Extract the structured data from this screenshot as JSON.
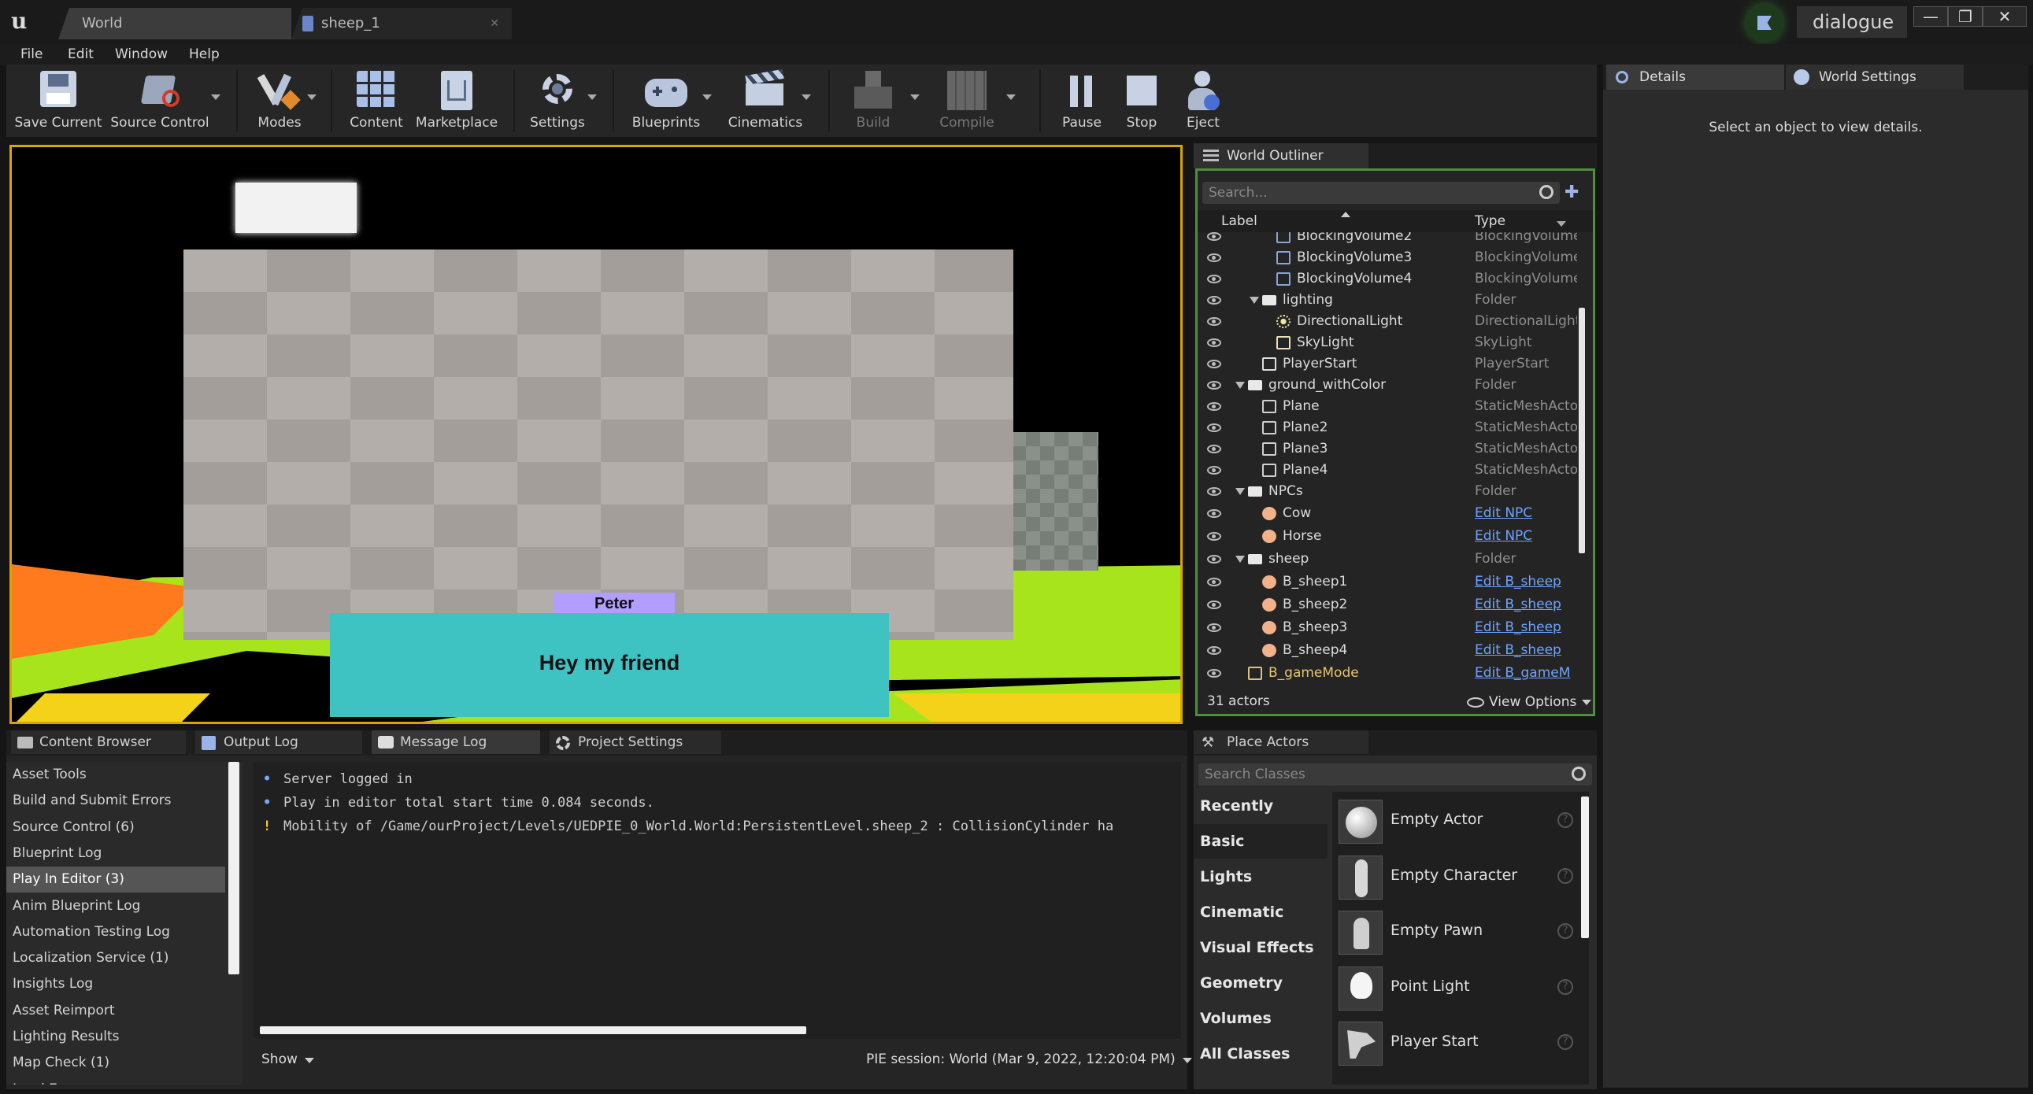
{
  "title_bar": {
    "tabs": [
      {
        "label": "World"
      },
      {
        "label": "sheep_1"
      }
    ],
    "right_label": "dialogue",
    "window_buttons": [
      "—",
      "❐",
      "✕"
    ]
  },
  "menu": [
    "File",
    "Edit",
    "Window",
    "Help"
  ],
  "toolbar": {
    "save_current": "Save Current",
    "source_control": "Source Control",
    "modes": "Modes",
    "content": "Content",
    "marketplace": "Marketplace",
    "settings": "Settings",
    "blueprints": "Blueprints",
    "cinematics": "Cinematics",
    "build": "Build",
    "compile": "Compile",
    "pause": "Pause",
    "stop": "Stop",
    "eject": "Eject"
  },
  "viewport": {
    "speaker_name": "Peter",
    "dialogue_text": "Hey my friend",
    "colors": {
      "speaker_bg": "#b39dff",
      "dialogue_bg": "#3ec2c2",
      "ground": "#a8e41c",
      "orange": "#ff7a1c",
      "frame": "#d9a400"
    }
  },
  "outliner": {
    "tab": "World Outliner",
    "search_placeholder": "Search...",
    "col_label": "Label",
    "col_type": "Type",
    "rows": [
      {
        "name": "BlockingVolume2",
        "type": "BlockingVolume",
        "icon": "volume-icon"
      },
      {
        "name": "BlockingVolume3",
        "type": "BlockingVolume",
        "icon": "volume-icon"
      },
      {
        "name": "BlockingVolume4",
        "type": "BlockingVolume",
        "icon": "volume-icon"
      },
      {
        "name": "lighting",
        "type": "Folder",
        "icon": "folder-icon"
      },
      {
        "name": "DirectionalLight",
        "type": "DirectionalLight",
        "icon": "sun-icon"
      },
      {
        "name": "SkyLight",
        "type": "SkyLight",
        "icon": "skylight-icon"
      },
      {
        "name": "PlayerStart",
        "type": "PlayerStart",
        "icon": "flag-icon"
      },
      {
        "name": "ground_withColor",
        "type": "Folder",
        "icon": "folder-icon"
      },
      {
        "name": "Plane",
        "type": "StaticMeshActor",
        "icon": "mesh-icon"
      },
      {
        "name": "Plane2",
        "type": "StaticMeshActor",
        "icon": "mesh-icon"
      },
      {
        "name": "Plane3",
        "type": "StaticMeshActor",
        "icon": "mesh-icon"
      },
      {
        "name": "Plane4",
        "type": "StaticMeshActor",
        "icon": "mesh-icon"
      },
      {
        "name": "NPCs",
        "type": "Folder",
        "icon": "folder-icon"
      },
      {
        "name": "Cow",
        "type": "Edit NPC",
        "icon": "actor-icon"
      },
      {
        "name": "Horse",
        "type": "Edit NPC",
        "icon": "actor-icon"
      },
      {
        "name": "sheep",
        "type": "Folder",
        "icon": "folder-icon"
      },
      {
        "name": "B_sheep1",
        "type": "Edit B_sheep",
        "icon": "actor-icon"
      },
      {
        "name": "B_sheep2",
        "type": "Edit B_sheep",
        "icon": "actor-icon"
      },
      {
        "name": "B_sheep3",
        "type": "Edit B_sheep",
        "icon": "actor-icon"
      },
      {
        "name": "B_sheep4",
        "type": "Edit B_sheep",
        "icon": "actor-icon"
      },
      {
        "name": "B_gameMode",
        "type": "Edit B_gameM",
        "icon": "gamemode-icon"
      }
    ],
    "actor_count": "31 actors",
    "view_options": "View Options"
  },
  "details": {
    "tab_details": "Details",
    "tab_world_settings": "World Settings",
    "empty_message": "Select an object to view details."
  },
  "bottom_tabs": [
    "Content Browser",
    "Output Log",
    "Message Log",
    "Project Settings"
  ],
  "message_log": {
    "categories": [
      "Asset Tools",
      "Build and Submit Errors",
      "Source Control (6)",
      "Blueprint Log",
      "Play In Editor (3)",
      "Anim Blueprint Log",
      "Automation Testing Log",
      "Localization Service (1)",
      "Insights Log",
      "Asset Reimport",
      "Lighting Results",
      "Map Check (1)",
      "Load Errors"
    ],
    "lines": [
      {
        "bullet": "•",
        "text": "Server logged in"
      },
      {
        "bullet": "•",
        "text": "Play in editor total start time 0.084 seconds."
      },
      {
        "bullet": "!",
        "text": "Mobility of /Game/ourProject/Levels/UEDPIE_0_World.World:PersistentLevel.sheep_2 : CollisionCylinder ha"
      }
    ],
    "show_label": "Show",
    "session_label": "PIE session: World (Mar 9, 2022, 12:20:04 PM)"
  },
  "place_actors": {
    "tab": "Place Actors",
    "search_placeholder": "Search Classes",
    "categories": [
      "Recently Placed",
      "Basic",
      "Lights",
      "Cinematic",
      "Visual Effects",
      "Geometry",
      "Volumes",
      "All Classes"
    ],
    "items": [
      "Empty Actor",
      "Empty Character",
      "Empty Pawn",
      "Point Light",
      "Player Start"
    ]
  }
}
